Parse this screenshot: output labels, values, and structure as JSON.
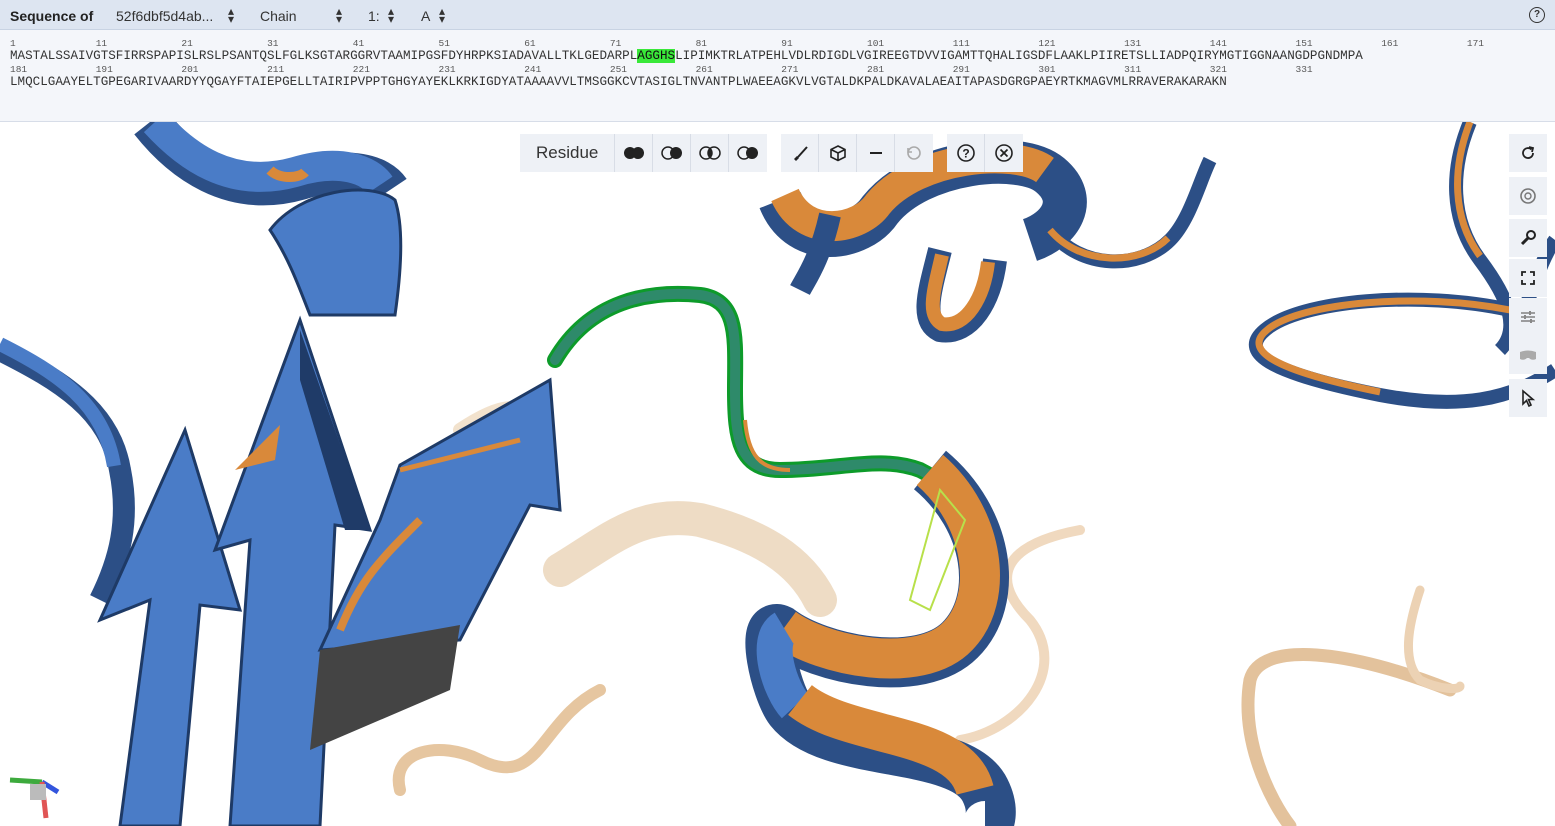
{
  "header": {
    "title": "Sequence of",
    "structure_select": "52f6dbf5d4ab...",
    "mode_select": "Chain",
    "model_select": "1:",
    "chain_select": "A"
  },
  "sequence": {
    "row1_numbers": [
      "1",
      "11",
      "21",
      "31",
      "41",
      "51",
      "61",
      "71",
      "81",
      "91",
      "101",
      "111",
      "121",
      "131",
      "141",
      "151",
      "161",
      "171"
    ],
    "row1_before": "MASTALSSAIVGTSFIRRSPAPISLRSLPSANTQSLFGLKSGTARGGRVTAAMIPGSFDYHRPKSIADAVALLTKLGEDARPL",
    "row1_highlight": "AGGHS",
    "row1_after": "LIPIMKTRLATPEHLVDLRDIGDLVGIREEGTDVVIGAMTTQHALIGSDFLAAKLPIIRETSLLIADPQIRYMGTIGGNAANGDPGNDMPA",
    "row2_numbers": [
      "181",
      "191",
      "201",
      "211",
      "221",
      "231",
      "241",
      "251",
      "261",
      "271",
      "281",
      "291",
      "301",
      "311",
      "321",
      "331"
    ],
    "row2": "LMQCLGAAYELTGPEGARIVAARDYYQGAYFTAIEPGELLTAIRIPVPPTGHGYAYEKLKRKIGDYATAAAAVVLTMSGGKCVTASIGLTNVANTPLWAEEAGKVLVGTALDKPALDKAVALAEAITAPASDGRGPAEYRTKMAGVMLRRAVERAKARAKN"
  },
  "toolbar": {
    "granularity_label": "Residue"
  },
  "colors": {
    "header_bg": "#dde5f1",
    "chain_blue": "#4a7cc7",
    "chain_orange": "#d9893a",
    "selection_green": "#39e839",
    "ghost_tan": "#e8c9a4"
  }
}
